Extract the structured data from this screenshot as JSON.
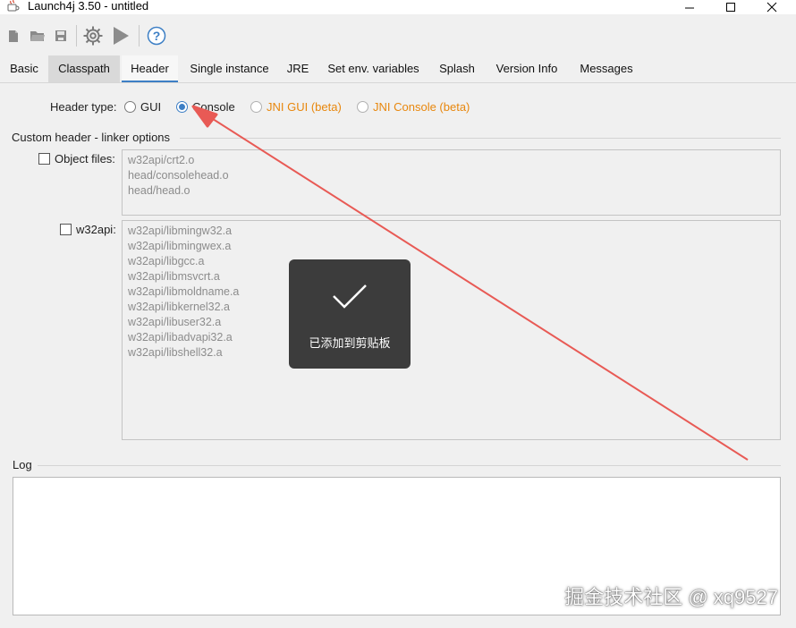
{
  "window": {
    "title": "Launch4j 3.50 - untitled",
    "controls": [
      "minimize",
      "maximize",
      "close"
    ]
  },
  "toolbar": {
    "icons": [
      "new-icon",
      "open-icon",
      "save-icon",
      "gear-icon",
      "run-icon",
      "help-icon"
    ]
  },
  "tabs": [
    {
      "label": "Basic"
    },
    {
      "label": "Classpath"
    },
    {
      "label": "Header"
    },
    {
      "label": "Single instance"
    },
    {
      "label": "JRE"
    },
    {
      "label": "Set env. variables"
    },
    {
      "label": "Splash"
    },
    {
      "label": "Version Info"
    },
    {
      "label": "Messages"
    }
  ],
  "selected_tab": "Header",
  "header_type": {
    "label": "Header type:",
    "options": [
      {
        "label": "GUI",
        "checked": false
      },
      {
        "label": "Console",
        "checked": true
      },
      {
        "label": "JNI GUI (beta)",
        "checked": false
      },
      {
        "label": "JNI Console (beta)",
        "checked": false
      }
    ]
  },
  "custom_header": {
    "title": "Custom header - linker options",
    "object_files": {
      "label": "Object files:",
      "checked": false,
      "lines": [
        "w32api/crt2.o",
        "head/consolehead.o",
        "head/head.o"
      ]
    },
    "w32api": {
      "label": "w32api:",
      "checked": false,
      "lines": [
        "w32api/libmingw32.a",
        "w32api/libmingwex.a",
        "w32api/libgcc.a",
        "w32api/libmsvcrt.a",
        "w32api/libmoldname.a",
        "w32api/libkernel32.a",
        "w32api/libuser32.a",
        "w32api/libadvapi32.a",
        "w32api/libshell32.a"
      ]
    }
  },
  "log": {
    "title": "Log",
    "content": ""
  },
  "toast": {
    "text": "已添加到剪贴板",
    "icon": "checkmark-icon"
  },
  "annotation": {
    "color": "#e85a55",
    "icon": "red-arrow"
  },
  "watermark": "掘金技术社区 @ xq9527",
  "colors": {
    "accent": "#3d7fc5",
    "beta_text": "#e8870d"
  }
}
